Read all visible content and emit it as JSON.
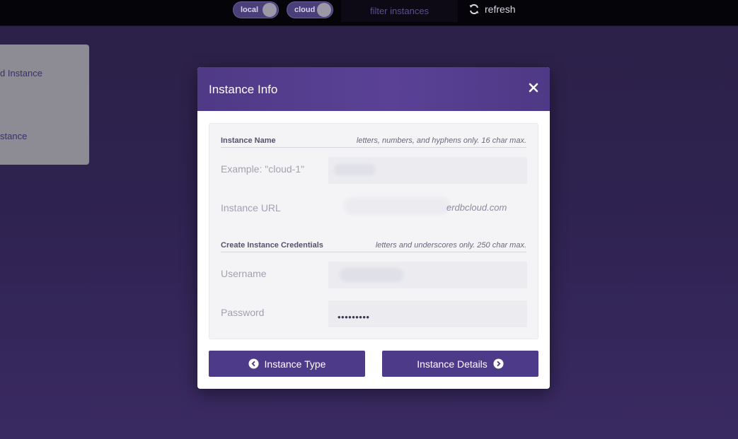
{
  "topbar": {
    "toggle_local": "local",
    "toggle_cloud": "cloud",
    "filter_placeholder": "filter instances",
    "refresh_label": "refresh"
  },
  "background_panel": {
    "item1": "d Instance",
    "item2": "stance"
  },
  "modal": {
    "title": "Instance Info",
    "section_name": {
      "title": "Instance Name",
      "hint": "letters, numbers, and hyphens only. 16 char max."
    },
    "name_field_label": "Example: \"cloud-1\"",
    "url_label": "Instance URL",
    "url_suffix": "erdbcloud.com",
    "section_credentials": {
      "title": "Create Instance Credentials",
      "hint": "letters and underscores only. 250 char max."
    },
    "username_label": "Username",
    "password_label": "Password",
    "password_value": "•••••••••",
    "prev_button": "Instance Type",
    "next_button": "Instance Details"
  },
  "colors": {
    "accent": "#4d3a88",
    "header": "#5a4196",
    "background": "#2e2250"
  }
}
